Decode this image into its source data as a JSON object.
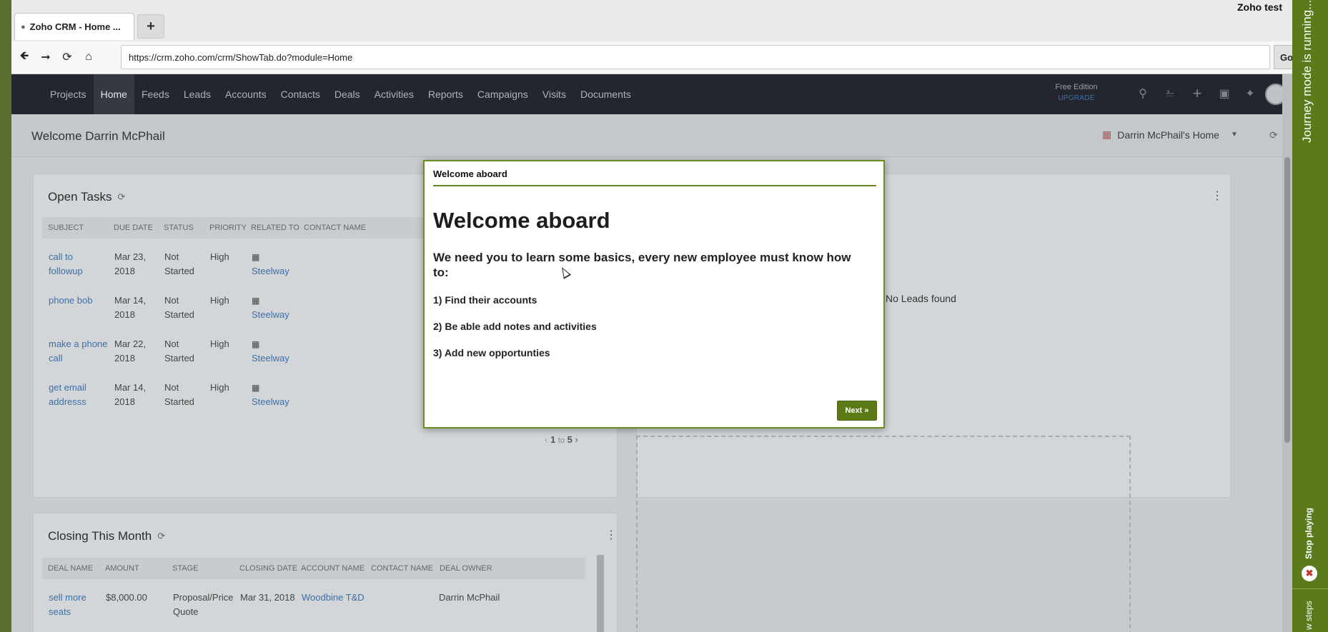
{
  "browser": {
    "tab_title": "Zoho CRM - Home ...",
    "new_tab_symbol": "+",
    "window_title": "Zoho test",
    "url": "https://crm.zoho.com/crm/ShowTab.do?module=Home",
    "go_label": "Go"
  },
  "nav": {
    "items": [
      "Projects",
      "Home",
      "Feeds",
      "Leads",
      "Accounts",
      "Contacts",
      "Deals",
      "Activities",
      "Reports",
      "Campaigns",
      "Visits",
      "Documents"
    ],
    "active_item": "Home",
    "edition": "Free Edition",
    "upgrade": "UPGRADE",
    "icons": [
      "search-icon",
      "bell-icon",
      "plus-icon",
      "calendar-icon",
      "tools-icon"
    ]
  },
  "page": {
    "welcome": "Welcome Darrin McPhail",
    "home_selector": "Darrin McPhail's Home"
  },
  "open_tasks": {
    "title": "Open Tasks",
    "columns": [
      "SUBJECT",
      "DUE DATE",
      "STATUS",
      "PRIORITY",
      "RELATED TO",
      "CONTACT NAME"
    ],
    "rows": [
      {
        "subject": [
          "call to",
          "followup"
        ],
        "due": [
          "Mar 23,",
          "2018"
        ],
        "status": [
          "Not",
          "Started"
        ],
        "priority": "High",
        "related": "Steelway"
      },
      {
        "subject": [
          "phone bob",
          ""
        ],
        "due": [
          "Mar 14,",
          "2018"
        ],
        "status": [
          "Not",
          "Started"
        ],
        "priority": "High",
        "related": "Steelway"
      },
      {
        "subject": [
          "make a phone",
          "call"
        ],
        "due": [
          "Mar 22,",
          "2018"
        ],
        "status": [
          "Not",
          "Started"
        ],
        "priority": "High",
        "related": "Steelway"
      },
      {
        "subject": [
          "get email",
          "addresss"
        ],
        "due": [
          "Mar 14,",
          "2018"
        ],
        "status": [
          "Not",
          "Started"
        ],
        "priority": "High",
        "related": "Steelway"
      }
    ],
    "pager": {
      "from": "1",
      "to_word": "to",
      "to": "5"
    }
  },
  "leads_panel": {
    "empty_text": "No Leads found"
  },
  "closing": {
    "title": "Closing This Month",
    "columns": [
      "DEAL NAME",
      "AMOUNT",
      "STAGE",
      "CLOSING DATE",
      "ACCOUNT NAME",
      "CONTACT NAME",
      "DEAL OWNER"
    ],
    "rows": [
      {
        "deal": [
          "sell more",
          "seats"
        ],
        "amount": "$8,000.00",
        "stage": [
          "Proposal/Price",
          "Quote"
        ],
        "closing_date": "Mar 31, 2018",
        "account": "Woodbine T&D",
        "contact": "",
        "owner": "Darrin McPhail"
      }
    ]
  },
  "modal": {
    "header": "Welcome aboard",
    "heading": "Welcome aboard",
    "intro": "We need you to learn some basics,  every new employee must know how to:",
    "steps": [
      "1) Find their accounts",
      "2) Be able add notes and activities",
      "3)  Add new opportunties"
    ],
    "next_label": "Next »"
  },
  "journey": {
    "status": "Journey mode is running...",
    "stop_label": "Stop playing",
    "steps_label": "w steps"
  },
  "colors": {
    "accent_green": "#5b7a1c",
    "nav_bg": "#23262d",
    "link": "#3d6fa6"
  }
}
